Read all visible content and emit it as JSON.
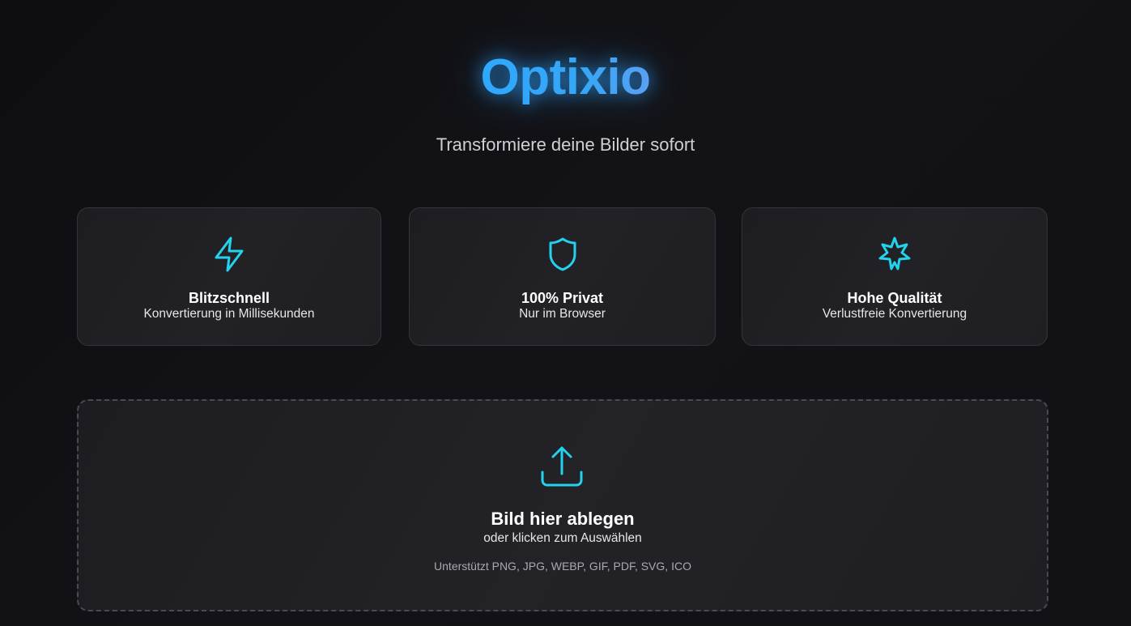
{
  "app": {
    "name": "Optixio",
    "tagline": "Transformiere deine Bilder sofort"
  },
  "features": [
    {
      "icon": "lightning-icon",
      "title": "Blitzschnell",
      "description": "Konvertierung in Millisekunden"
    },
    {
      "icon": "shield-icon",
      "title": "100% Privat",
      "description": "Nur im Browser"
    },
    {
      "icon": "sparkle-icon",
      "title": "Hohe Qualität",
      "description": "Verlustfreie Konvertierung"
    }
  ],
  "dropzone": {
    "icon": "upload-icon",
    "title": "Bild hier ablegen",
    "subtitle": "oder klicken zum Auswählen",
    "formats": "Unterstützt PNG, JPG, WEBP, GIF, PDF, SVG, ICO"
  },
  "colors": {
    "background": "#111115",
    "card": "#1f1f23",
    "accent": "#22d3ee",
    "logo": "#2ea8ff"
  }
}
